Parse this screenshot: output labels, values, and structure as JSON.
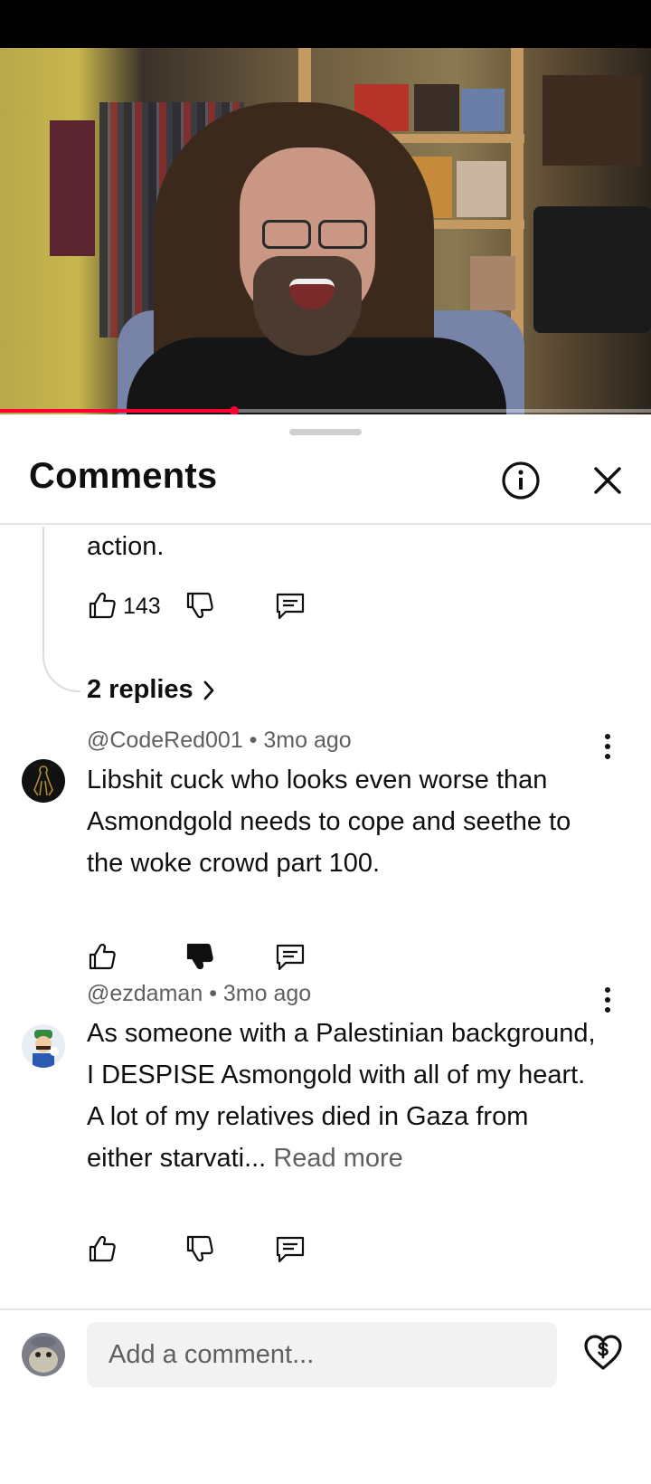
{
  "sheet": {
    "title": "Comments",
    "info_icon": "info-icon",
    "close_icon": "close-icon"
  },
  "video": {
    "progress_fraction": 0.36
  },
  "thread": {
    "text_tail": "action.",
    "like_count": "143",
    "replies_label": "2 replies"
  },
  "comments": [
    {
      "handle": "@CodeRed001",
      "age": "3mo ago",
      "text": "Libshit cuck who looks even worse than Asmondgold needs to cope and seethe to the woke crowd part 100.",
      "disliked": true
    },
    {
      "handle": "@ezdaman",
      "age": "3mo ago",
      "text": "As someone with a Palestinian background, I DESPISE Asmongold with all of my heart. A lot of my relatives died in Gaza from either starvati...",
      "read_more": "Read more",
      "disliked": false
    }
  ],
  "composer": {
    "placeholder": "Add a comment...",
    "thanks_icon": "super-thanks-icon"
  },
  "colors": {
    "accent": "#ff0033",
    "text": "#0f0f0f",
    "secondary": "#606060"
  }
}
